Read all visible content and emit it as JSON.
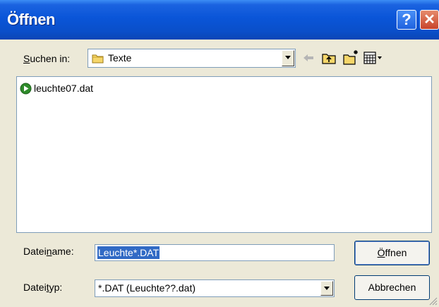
{
  "window": {
    "title": "Öffnen",
    "help_label": "?",
    "close_label": "✕"
  },
  "lookin": {
    "label_prefix": "S",
    "label_rest": "uchen in:",
    "value": "Texte"
  },
  "toolbar": {
    "icons": [
      "back-arrow-icon",
      "up-folder-icon",
      "new-folder-icon",
      "view-menu-icon"
    ]
  },
  "files": [
    {
      "name": "leuchte07.dat",
      "icon": "play-file-icon"
    }
  ],
  "filename": {
    "label_pre": "Datei",
    "label_accel": "n",
    "label_post": "ame:",
    "value": "Leuchte*.DAT"
  },
  "filetype": {
    "label_pre": "Datei",
    "label_accel": "t",
    "label_post": "yp:",
    "value": "*.DAT (Leuchte??.dat)"
  },
  "buttons": {
    "open_accel": "Ö",
    "open_rest": "ffnen",
    "cancel": "Abbrechen"
  },
  "colors": {
    "titlebar": "#0a55d8",
    "selection": "#316ac5",
    "dialog_bg": "#ece9d8"
  }
}
